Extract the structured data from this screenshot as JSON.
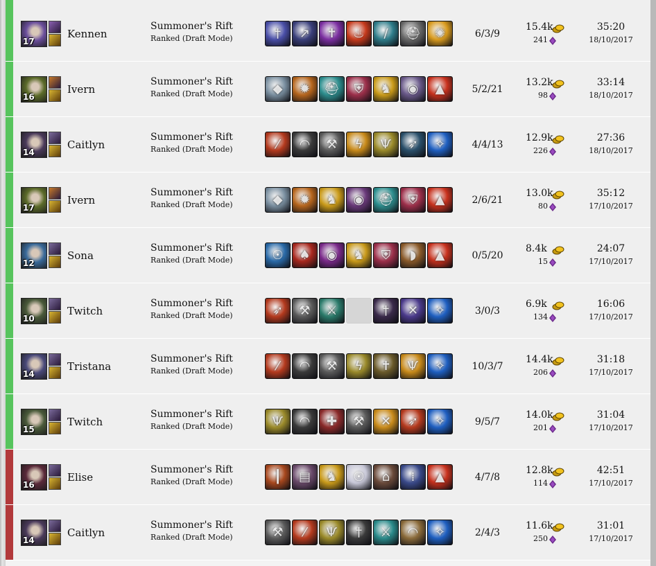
{
  "colors": {
    "win": "#57c45d",
    "loss": "#b2393b"
  },
  "matches": [
    {
      "result": "win",
      "champion": "Kennen",
      "level": "17",
      "portrait": "#6b4f9c",
      "portrait_icon": "kennen-portrait-icon",
      "spells": [
        "#8a5fb0",
        "#d9b532"
      ],
      "mode": "Summoner's Rift",
      "queue": "Ranked (Draft Mode)",
      "items": [
        {
          "icon": "sword-icon",
          "color": "#4a4fa8"
        },
        {
          "icon": "spear-icon",
          "color": "#3a3f7a"
        },
        {
          "icon": "dagger-icon",
          "color": "#7b2fa0"
        },
        {
          "icon": "flame-icon",
          "color": "#c63a1c"
        },
        {
          "icon": "blade-icon",
          "color": "#2f7d8a"
        },
        {
          "icon": "helm-icon",
          "color": "#6a6a6a"
        },
        {
          "icon": "lantern-icon",
          "color": "#d89a1e"
        }
      ],
      "kda": "6/3/9",
      "gold": "15.4k",
      "cs": "241",
      "duration": "35:20",
      "date": "18/10/2017"
    },
    {
      "result": "win",
      "champion": "Ivern",
      "level": "16",
      "portrait": "#5c6b2a",
      "portrait_icon": "ivern-portrait-icon",
      "spells": [
        "#c77a2a",
        "#d9b532"
      ],
      "mode": "Summoner's Rift",
      "queue": "Ranked (Draft Mode)",
      "items": [
        {
          "icon": "gem-icon",
          "color": "#7a8fa0"
        },
        {
          "icon": "sun-shield-icon",
          "color": "#b5651d"
        },
        {
          "icon": "helm-icon",
          "color": "#2e8f8f"
        },
        {
          "icon": "shield-icon",
          "color": "#9c2f4a"
        },
        {
          "icon": "boots-icon",
          "color": "#c99a1a"
        },
        {
          "icon": "orb-icon",
          "color": "#6a5a8a"
        },
        {
          "icon": "totem-icon",
          "color": "#c8321e"
        }
      ],
      "kda": "5/2/21",
      "gold": "13.2k",
      "cs": "98",
      "duration": "33:14",
      "date": "18/10/2017"
    },
    {
      "result": "win",
      "champion": "Caitlyn",
      "level": "14",
      "portrait": "#4a3a5a",
      "portrait_icon": "caitlyn-portrait-icon",
      "spells": [
        "#7a6a9a",
        "#d9b532"
      ],
      "mode": "Summoner's Rift",
      "queue": "Ranked (Draft Mode)",
      "items": [
        {
          "icon": "rifle-icon",
          "color": "#b43a1e"
        },
        {
          "icon": "cloak-icon",
          "color": "#3a3a3a"
        },
        {
          "icon": "axe-icon",
          "color": "#5a5a5a"
        },
        {
          "icon": "lightning-blade-icon",
          "color": "#c88a1a"
        },
        {
          "icon": "claw-icon",
          "color": "#9a8a2a"
        },
        {
          "icon": "bow-icon",
          "color": "#2a4f6a"
        },
        {
          "icon": "ward-icon",
          "color": "#1f5fc0"
        }
      ],
      "kda": "4/4/13",
      "gold": "12.9k",
      "cs": "226",
      "duration": "27:36",
      "date": "18/10/2017"
    },
    {
      "result": "win",
      "champion": "Ivern",
      "level": "17",
      "portrait": "#5c6b2a",
      "portrait_icon": "ivern-portrait-icon",
      "spells": [
        "#c77a2a",
        "#d9b532"
      ],
      "mode": "Summoner's Rift",
      "queue": "Ranked (Draft Mode)",
      "items": [
        {
          "icon": "gem-icon",
          "color": "#7a8fa0"
        },
        {
          "icon": "sun-shield-icon",
          "color": "#b5651d"
        },
        {
          "icon": "boots-icon",
          "color": "#c99a1a"
        },
        {
          "icon": "orb-icon",
          "color": "#6a3a7a"
        },
        {
          "icon": "helm-icon",
          "color": "#2e8f8f"
        },
        {
          "icon": "shield-icon",
          "color": "#9c2f4a"
        },
        {
          "icon": "totem-icon",
          "color": "#c8321e"
        }
      ],
      "kda": "2/6/21",
      "gold": "13.0k",
      "cs": "80",
      "duration": "35:12",
      "date": "17/10/2017"
    },
    {
      "result": "win",
      "champion": "Sona",
      "level": "12",
      "portrait": "#3a6a9a",
      "portrait_icon": "sona-portrait-icon",
      "spells": [
        "#7a6a9a",
        "#d9b532"
      ],
      "mode": "Summoner's Rift",
      "queue": "Ranked (Draft Mode)",
      "items": [
        {
          "icon": "mask-icon",
          "color": "#2a6aa8"
        },
        {
          "icon": "mushroom-icon",
          "color": "#a8281e"
        },
        {
          "icon": "orb-icon",
          "color": "#7a2a8a"
        },
        {
          "icon": "boots-icon",
          "color": "#c99a1a"
        },
        {
          "icon": "shield-icon",
          "color": "#9c2f4a"
        },
        {
          "icon": "horn-icon",
          "color": "#8a5a2a"
        },
        {
          "icon": "totem-icon",
          "color": "#c8321e"
        }
      ],
      "kda": "0/5/20",
      "gold": "8.4k",
      "cs": "15",
      "duration": "24:07",
      "date": "17/10/2017"
    },
    {
      "result": "win",
      "champion": "Twitch",
      "level": "10",
      "portrait": "#4a5a3a",
      "portrait_icon": "twitch-portrait-icon",
      "spells": [
        "#7a6a9a",
        "#d9b532"
      ],
      "mode": "Summoner's Rift",
      "queue": "Ranked (Draft Mode)",
      "items": [
        {
          "icon": "bow-icon",
          "color": "#b43a1e"
        },
        {
          "icon": "axe-icon",
          "color": "#5a5a5a"
        },
        {
          "icon": "cutlass-icon",
          "color": "#2a7a6a"
        },
        {
          "icon": "empty-slot",
          "color": ""
        },
        {
          "icon": "sword-icon",
          "color": "#3a2a4a"
        },
        {
          "icon": "crossed-blades-icon",
          "color": "#4a3a8a"
        },
        {
          "icon": "ward-icon",
          "color": "#1f5fc0"
        }
      ],
      "kda": "3/0/3",
      "gold": "6.9k",
      "cs": "134",
      "duration": "16:06",
      "date": "17/10/2017"
    },
    {
      "result": "win",
      "champion": "Tristana",
      "level": "14",
      "portrait": "#4a4a7a",
      "portrait_icon": "tristana-portrait-icon",
      "spells": [
        "#7a6a9a",
        "#d9b532"
      ],
      "mode": "Summoner's Rift",
      "queue": "Ranked (Draft Mode)",
      "items": [
        {
          "icon": "rifle-icon",
          "color": "#b43a1e"
        },
        {
          "icon": "cloak-icon",
          "color": "#3a3a3a"
        },
        {
          "icon": "axe-icon",
          "color": "#5a5a5a"
        },
        {
          "icon": "lightning-blade-icon",
          "color": "#9a8a2a"
        },
        {
          "icon": "dagger-icon",
          "color": "#6a5a2a"
        },
        {
          "icon": "claw-icon",
          "color": "#c88a1a"
        },
        {
          "icon": "ward-icon",
          "color": "#1f5fc0"
        }
      ],
      "kda": "10/3/7",
      "gold": "14.4k",
      "cs": "206",
      "duration": "31:18",
      "date": "17/10/2017"
    },
    {
      "result": "win",
      "champion": "Twitch",
      "level": "15",
      "portrait": "#4a5a3a",
      "portrait_icon": "twitch-portrait-icon",
      "spells": [
        "#7a6a9a",
        "#d9b532"
      ],
      "mode": "Summoner's Rift",
      "queue": "Ranked (Draft Mode)",
      "items": [
        {
          "icon": "claw-icon",
          "color": "#9a8a2a"
        },
        {
          "icon": "cloak-icon",
          "color": "#3a3a3a"
        },
        {
          "icon": "crossbow-icon",
          "color": "#8a2a2a"
        },
        {
          "icon": "axe-icon",
          "color": "#5a5a5a"
        },
        {
          "icon": "crossed-blades-icon",
          "color": "#c88a1a"
        },
        {
          "icon": "bow-icon",
          "color": "#b43a1e"
        },
        {
          "icon": "ward-icon",
          "color": "#1f5fc0"
        }
      ],
      "kda": "9/5/7",
      "gold": "14.0k",
      "cs": "201",
      "duration": "31:04",
      "date": "17/10/2017"
    },
    {
      "result": "loss",
      "champion": "Elise",
      "level": "16",
      "portrait": "#5a2a3a",
      "portrait_icon": "elise-portrait-icon",
      "spells": [
        "#7a6a9a",
        "#d9b532"
      ],
      "mode": "Summoner's Rift",
      "queue": "Ranked (Draft Mode)",
      "items": [
        {
          "icon": "staff-icon",
          "color": "#a8481e"
        },
        {
          "icon": "tome-icon",
          "color": "#6a4a6a"
        },
        {
          "icon": "boots-icon",
          "color": "#c99a1a"
        },
        {
          "icon": "mask-icon",
          "color": "#c8c8d8"
        },
        {
          "icon": "hat-icon",
          "color": "#6a4a3a"
        },
        {
          "icon": "wand-icon",
          "color": "#3a4a8a"
        },
        {
          "icon": "totem-icon",
          "color": "#c8321e"
        }
      ],
      "kda": "4/7/8",
      "gold": "12.8k",
      "cs": "114",
      "duration": "42:51",
      "date": "17/10/2017"
    },
    {
      "result": "loss",
      "champion": "Caitlyn",
      "level": "14",
      "portrait": "#4a3a5a",
      "portrait_icon": "caitlyn-portrait-icon",
      "spells": [
        "#7a6a9a",
        "#d9b532"
      ],
      "mode": "Summoner's Rift",
      "queue": "Ranked (Draft Mode)",
      "items": [
        {
          "icon": "axe-icon",
          "color": "#5a5a5a"
        },
        {
          "icon": "rifle-icon",
          "color": "#b43a1e"
        },
        {
          "icon": "claw-icon",
          "color": "#9a8a2a"
        },
        {
          "icon": "sword-icon",
          "color": "#3a3a3a"
        },
        {
          "icon": "cutlass-icon",
          "color": "#2a8a8a"
        },
        {
          "icon": "cloak-icon",
          "color": "#8a6a3a"
        },
        {
          "icon": "ward-icon",
          "color": "#1f5fc0"
        }
      ],
      "kda": "2/4/3",
      "gold": "11.6k",
      "cs": "250",
      "duration": "31:01",
      "date": "17/10/2017"
    }
  ]
}
